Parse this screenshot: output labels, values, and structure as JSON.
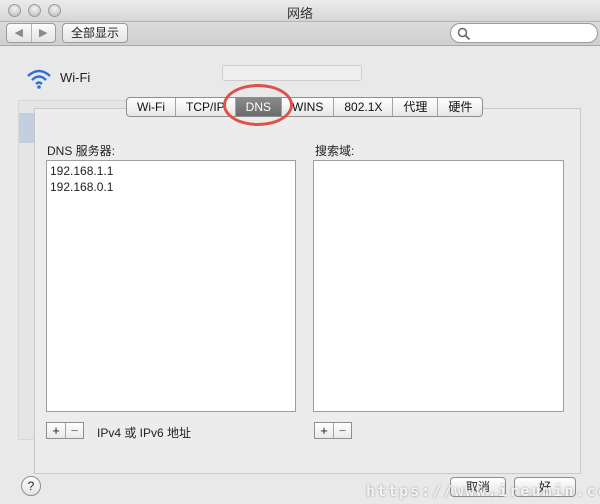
{
  "window": {
    "title": "网络"
  },
  "toolbar": {
    "back_label": "◀",
    "forward_label": "▶",
    "show_all_label": "全部显示",
    "search_placeholder": ""
  },
  "background": {
    "wifi_label": "Wi-Fi"
  },
  "tabs": [
    {
      "label": "Wi-Fi",
      "active": false
    },
    {
      "label": "TCP/IP",
      "active": false
    },
    {
      "label": "DNS",
      "active": true
    },
    {
      "label": "WINS",
      "active": false
    },
    {
      "label": "802.1X",
      "active": false
    },
    {
      "label": "代理",
      "active": false
    },
    {
      "label": "硬件",
      "active": false
    }
  ],
  "dns": {
    "servers_label": "DNS 服务器:",
    "servers": [
      "192.168.1.1",
      "192.168.0.1"
    ],
    "search_domains_label": "搜索域:",
    "search_domains": [],
    "address_hint": "IPv4 或 IPv6 地址"
  },
  "controls": {
    "add": "+",
    "remove": "−",
    "help": "?",
    "cancel": "取消",
    "ok": "好"
  },
  "watermark": "https://www.ireumin.cc",
  "colors": {
    "active_tab": "#7a7a7a",
    "annotation_ring": "#e0514a"
  }
}
